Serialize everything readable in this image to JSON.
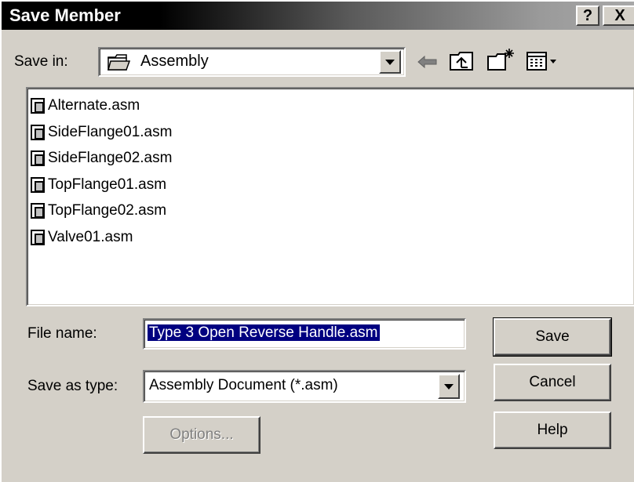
{
  "window": {
    "title": "Save Member",
    "help_button": "?",
    "close_button": "X"
  },
  "save_in": {
    "label": "Save in:",
    "value": "Assembly",
    "toolbar_icons": [
      "back-arrow-icon",
      "up-one-level-icon",
      "create-new-folder-icon",
      "view-menu-icon"
    ]
  },
  "file_list": {
    "items": [
      {
        "name": "Alternate.asm"
      },
      {
        "name": "SideFlange01.asm"
      },
      {
        "name": "SideFlange02.asm"
      },
      {
        "name": "TopFlange01.asm"
      },
      {
        "name": "TopFlange02.asm"
      },
      {
        "name": "Valve01.asm"
      }
    ]
  },
  "file_name": {
    "label": "File name:",
    "value": "Type 3 Open Reverse Handle.asm"
  },
  "save_as_type": {
    "label": "Save as type:",
    "value": "Assembly Document (*.asm)"
  },
  "buttons": {
    "save": "Save",
    "cancel": "Cancel",
    "help": "Help",
    "options": "Options..."
  },
  "colors": {
    "titlebar_start": "#000000",
    "titlebar_end": "#a8a8a8",
    "face": "#d4d0c8",
    "selection": "#000080"
  }
}
